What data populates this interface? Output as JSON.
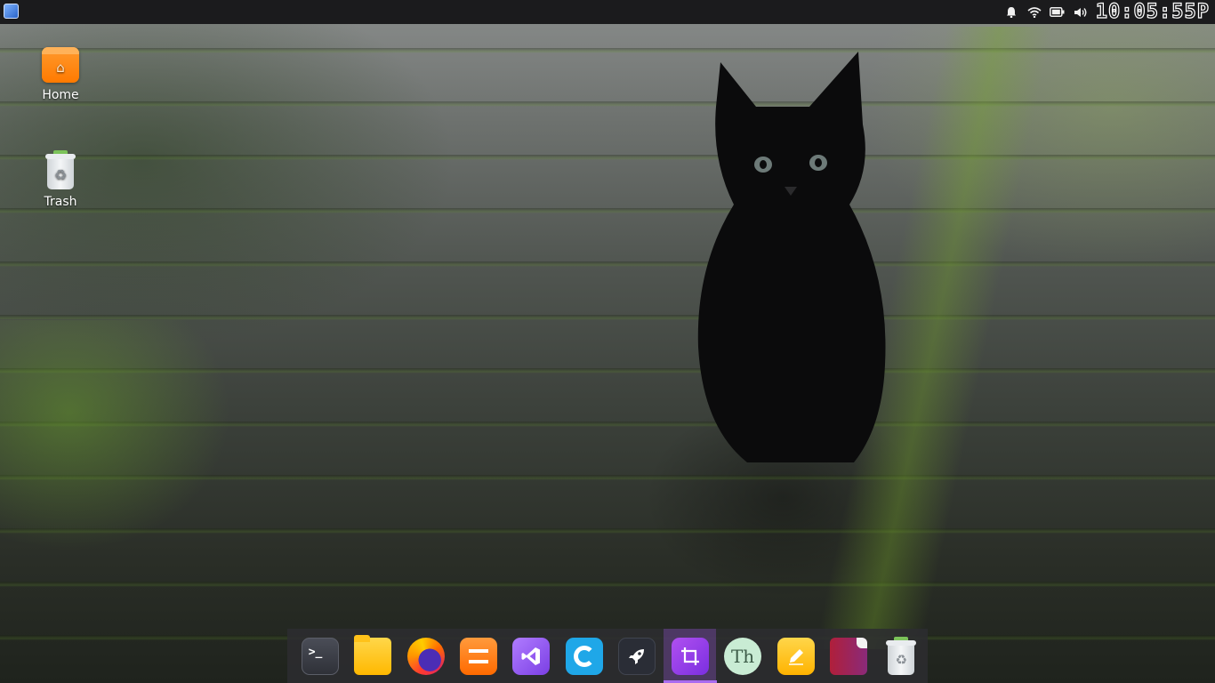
{
  "desktop": {
    "icons": [
      {
        "label": "Home",
        "icon": "home-folder-icon"
      },
      {
        "label": "Trash",
        "icon": "trash-icon"
      }
    ]
  },
  "top_panel": {
    "launcher_icon": "app-launcher-icon",
    "tray": [
      "notification-bell-icon",
      "wifi-icon",
      "battery-icon",
      "volume-icon"
    ],
    "clock": "10:05:55P"
  },
  "dock": {
    "items": [
      {
        "name": "terminal",
        "glyph": ">_"
      },
      {
        "name": "files"
      },
      {
        "name": "firefox"
      },
      {
        "name": "sublime-text"
      },
      {
        "name": "visual-studio-code"
      },
      {
        "name": "c-app"
      },
      {
        "name": "rocket-app"
      },
      {
        "name": "screenshot-crop",
        "active": true
      },
      {
        "name": "font-viewer",
        "glyph": "Th"
      },
      {
        "name": "notes"
      },
      {
        "name": "books"
      },
      {
        "name": "trash"
      }
    ]
  },
  "colors": {
    "panel": "#1b1b1d",
    "accent": "#a96cf0",
    "home_folder": "#ff7a00"
  }
}
